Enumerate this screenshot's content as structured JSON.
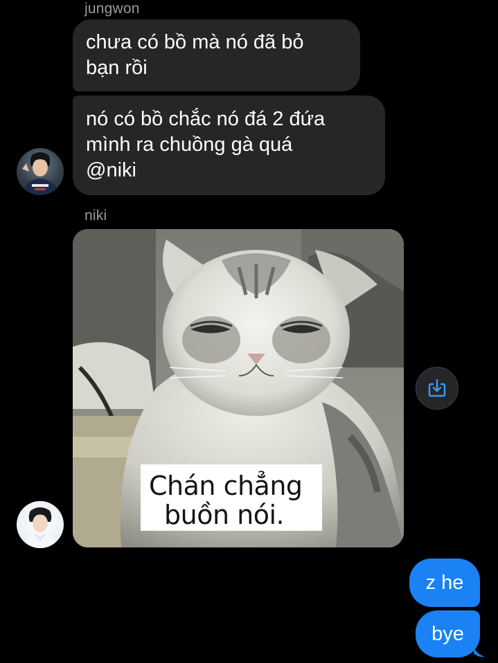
{
  "thread": {
    "group_jungwon": {
      "sender": "jungwon",
      "messages": [
        "chưa có bồ mà nó đã bỏ\nbạn rồi",
        "nó có bồ chắc nó đá 2 đứa\nmình ra chuồng gà quá\n@niki"
      ]
    },
    "group_niki": {
      "sender": "niki",
      "image_caption": {
        "line1": "Chán chẳng",
        "line2": "buồn nói."
      }
    },
    "outgoing": [
      "z he",
      "bye"
    ]
  },
  "icons": {
    "save": "download-icon",
    "avatar_jungwon": "avatar-jungwon",
    "avatar_niki": "avatar-niki"
  },
  "colors": {
    "background": "#000000",
    "incoming_bubble": "#262628",
    "outgoing_bubble": "#1a82f5",
    "sender_name": "#9a9a9a",
    "accent_icon": "#3a9bf7"
  }
}
